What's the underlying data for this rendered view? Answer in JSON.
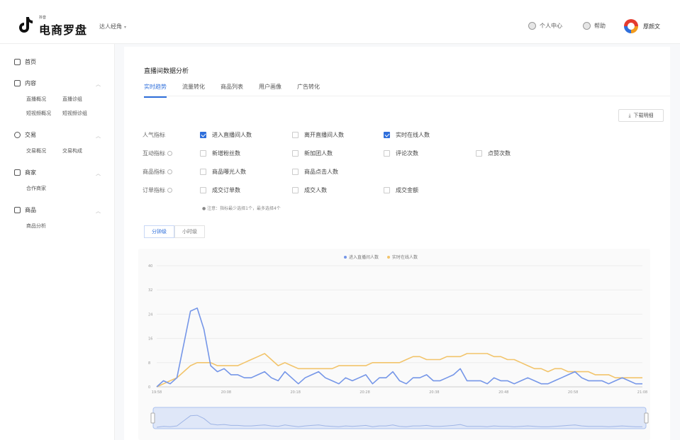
{
  "header": {
    "logo_small": "抖音",
    "logo_main": "电商罗盘",
    "role": "达人经角",
    "links": [
      {
        "label": "个人中心"
      },
      {
        "label": "帮助"
      }
    ],
    "username": "厚颜文"
  },
  "sidebar": {
    "groups": [
      {
        "label": "首页",
        "icon": "home-icon",
        "subs": []
      },
      {
        "label": "内容",
        "icon": "document-icon",
        "subs": [
          [
            "直播概况",
            "直播诊组"
          ],
          [
            "短视频概况",
            "短视频诊组"
          ]
        ]
      },
      {
        "label": "交易",
        "icon": "trade-icon",
        "subs": [
          [
            "交易概况",
            "交易构成"
          ]
        ]
      },
      {
        "label": "商家",
        "icon": "shop-icon",
        "subs": [
          [
            "合作商家"
          ]
        ]
      },
      {
        "label": "商品",
        "icon": "goods-icon",
        "subs": [
          [
            "商品分析"
          ]
        ]
      }
    ]
  },
  "main": {
    "title": "直播间数据分析",
    "tabs": [
      "实时趋势",
      "流量转化",
      "商品列表",
      "用户画像",
      "广告转化"
    ],
    "active_tab": 0,
    "download_label": "下载明细",
    "metric_rows": [
      {
        "label": "人气指标",
        "info": false,
        "items": [
          {
            "label": "进入直播间人数",
            "checked": true
          },
          {
            "label": "离开直播间人数",
            "checked": false
          },
          {
            "label": "实时在线人数",
            "checked": true
          }
        ]
      },
      {
        "label": "互动指标",
        "info": true,
        "items": [
          {
            "label": "新增粉丝数",
            "checked": false
          },
          {
            "label": "新加团人数",
            "checked": false
          },
          {
            "label": "评论次数",
            "checked": false
          },
          {
            "label": "点赞次数",
            "checked": false
          }
        ]
      },
      {
        "label": "商品指标",
        "info": true,
        "items": [
          {
            "label": "商品曝光人数",
            "checked": false
          },
          {
            "label": "商品点击人数",
            "checked": false
          }
        ]
      },
      {
        "label": "订单指标",
        "info": true,
        "items": [
          {
            "label": "成交订单数",
            "checked": false
          },
          {
            "label": "成交人数",
            "checked": false
          },
          {
            "label": "成交金额",
            "checked": false
          }
        ]
      }
    ],
    "note": "注意：指标最少选择1个，最多选择4个",
    "granularity": [
      "分钟级",
      "小时级"
    ],
    "active_granularity": 0
  },
  "colors": {
    "accent": "#2f6fdb",
    "series_blue": "#7596e8",
    "series_yellow": "#f2c46b"
  },
  "chart_data": {
    "type": "line",
    "x_ticks": [
      "19:58",
      "20:08",
      "20:18",
      "20:28",
      "20:38",
      "20:48",
      "20:58",
      "21:08"
    ],
    "x_start_min": 0,
    "x_end_min": 72,
    "ylim": [
      0,
      40
    ],
    "y_ticks": [
      0,
      8,
      16,
      24,
      32,
      40
    ],
    "series": [
      {
        "name": "进入直播间人数",
        "color": "#7596e8",
        "values": [
          0,
          2,
          1,
          3,
          14,
          25,
          26,
          19,
          7,
          5,
          6,
          4,
          4,
          3,
          3,
          4,
          5,
          3,
          2,
          5,
          3,
          1,
          3,
          4,
          5,
          3,
          2,
          1,
          3,
          2,
          3,
          4,
          1,
          3,
          3,
          5,
          2,
          1,
          3,
          3,
          4,
          2,
          2,
          3,
          4,
          6,
          2,
          2,
          2,
          1,
          3,
          2,
          2,
          1,
          2,
          3,
          2,
          1,
          1,
          2,
          3,
          4,
          5,
          3,
          2,
          2,
          2,
          1,
          2,
          3,
          2,
          1,
          1
        ]
      },
      {
        "name": "实时在线人数",
        "color": "#f2c46b",
        "values": [
          0,
          1,
          2,
          3,
          5,
          7,
          8,
          8,
          8,
          7,
          7,
          7,
          7,
          8,
          9,
          10,
          11,
          9,
          7,
          8,
          7,
          6,
          6,
          6,
          6,
          6,
          6,
          7,
          7,
          7,
          7,
          7,
          8,
          8,
          8,
          8,
          8,
          9,
          10,
          10,
          9,
          9,
          9,
          10,
          10,
          10,
          11,
          11,
          11,
          11,
          10,
          10,
          9,
          9,
          8,
          7,
          6,
          6,
          5,
          6,
          6,
          5,
          5,
          5,
          5,
          4,
          4,
          4,
          3,
          3,
          3,
          3,
          3
        ]
      }
    ]
  }
}
